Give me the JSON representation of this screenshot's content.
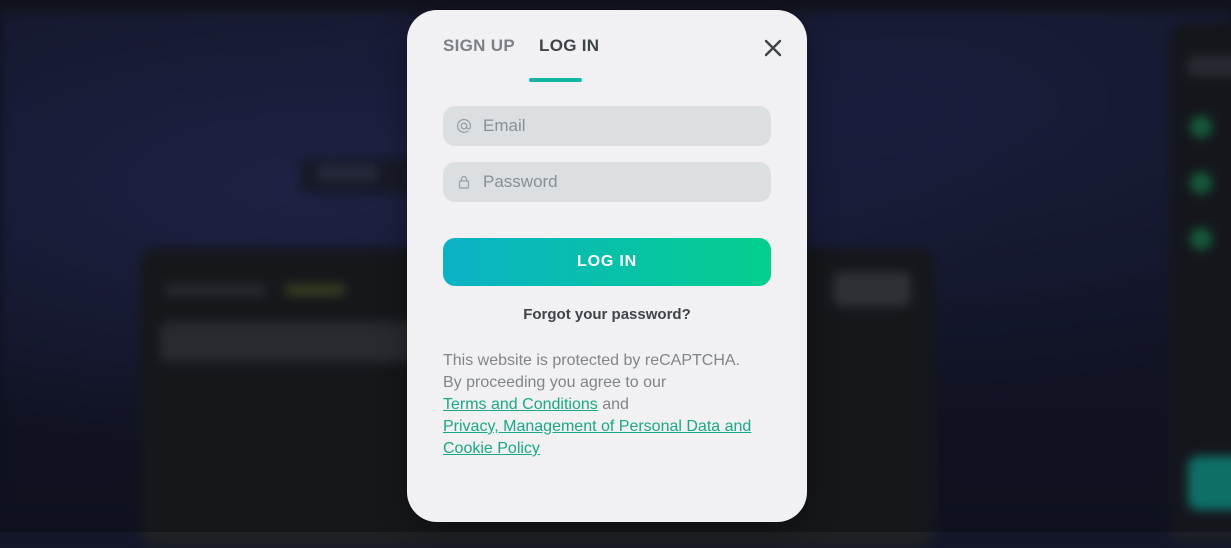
{
  "modal": {
    "tabs": [
      {
        "label": "SIGN UP",
        "active": false
      },
      {
        "label": "LOG IN",
        "active": true
      }
    ],
    "close_icon": "close-icon",
    "email": {
      "placeholder": "Email",
      "value": "",
      "icon": "at-icon"
    },
    "password": {
      "placeholder": "Password",
      "value": "",
      "icon": "lock-icon"
    },
    "login_button": "LOG IN",
    "forgot_link": "Forgot your password?",
    "legal": {
      "line1": "This website is protected by reCAPTCHA.",
      "line2": "By proceeding you agree to our",
      "terms_link": "Terms and Conditions",
      "and": "and",
      "privacy_link": "Privacy, Management of Personal Data and Cookie Policy"
    }
  },
  "colors": {
    "accent": "#12b5a6",
    "button_gradient_start": "#0bb2c6",
    "button_gradient_end": "#04cf8e",
    "link": "#1aa886",
    "modal_bg": "#f1f1f3"
  }
}
